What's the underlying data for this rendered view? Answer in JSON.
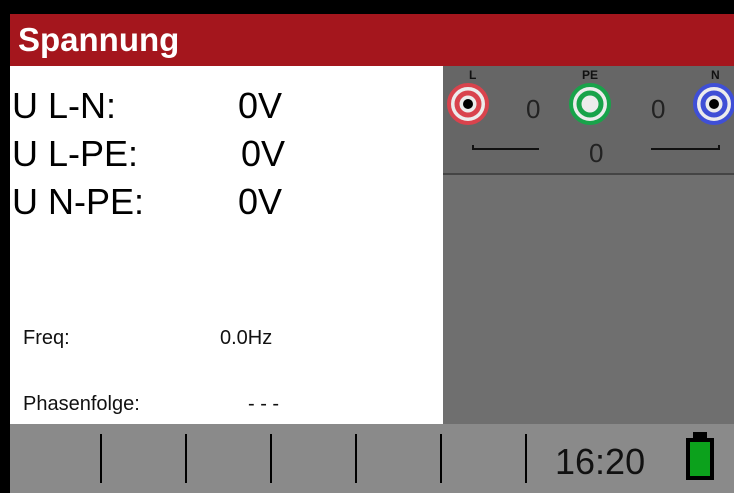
{
  "header": {
    "title": "Spannung"
  },
  "readings": [
    {
      "label": "U L-N:",
      "value": "0V"
    },
    {
      "label": "U L-PE:",
      "value": "0V"
    },
    {
      "label": "U N-PE:",
      "value": "0V"
    }
  ],
  "freq": {
    "label": "Freq:",
    "value": "0.0Hz"
  },
  "phase": {
    "label": "Phasenfolge:",
    "value": "- - -"
  },
  "terminals": {
    "l_label": "L",
    "pe_label": "PE",
    "n_label": "N",
    "l_pe_value": "0",
    "pe_n_value": "0",
    "l_n_value": "0",
    "colors": {
      "L": "#d9434d",
      "PE": "#18a34a",
      "N": "#3f4fd6"
    }
  },
  "status": {
    "time": "16:20",
    "battery": "battery-full-icon"
  }
}
